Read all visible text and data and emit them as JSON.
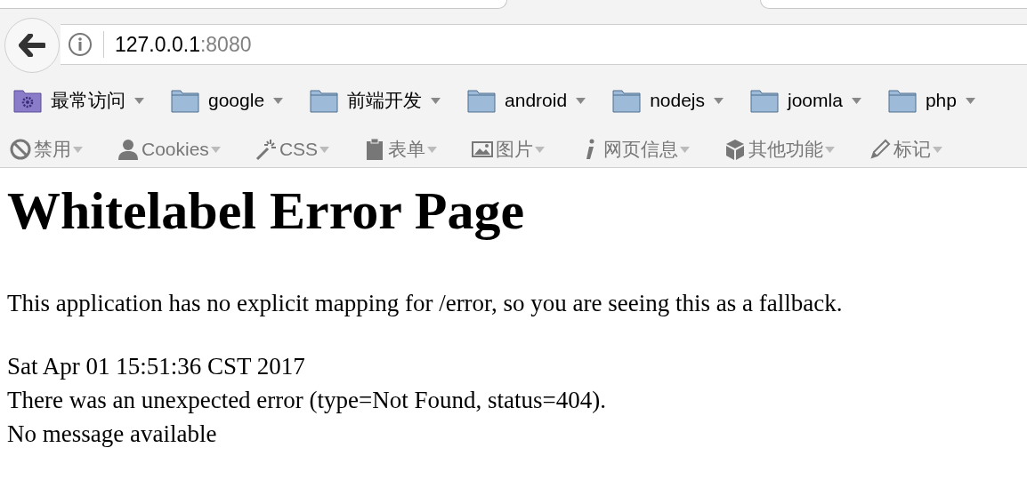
{
  "address_bar": {
    "host": "127.0.0.1",
    "port": ":8080"
  },
  "bookmarks": [
    {
      "label": "最常访问",
      "kind": "smart"
    },
    {
      "label": "google",
      "kind": "folder"
    },
    {
      "label": "前端开发",
      "kind": "folder"
    },
    {
      "label": "android",
      "kind": "folder"
    },
    {
      "label": "nodejs",
      "kind": "folder"
    },
    {
      "label": "joomla",
      "kind": "folder"
    },
    {
      "label": "php",
      "kind": "folder"
    }
  ],
  "dev_toolbar": [
    {
      "label": "禁用",
      "kind": "disable"
    },
    {
      "label": "Cookies",
      "kind": "cookies"
    },
    {
      "label": "CSS",
      "kind": "css"
    },
    {
      "label": "表单",
      "kind": "forms"
    },
    {
      "label": "图片",
      "kind": "images"
    },
    {
      "label": "网页信息",
      "kind": "info"
    },
    {
      "label": "其他功能",
      "kind": "misc"
    },
    {
      "label": "标记",
      "kind": "outline"
    }
  ],
  "page": {
    "title": "Whitelabel Error Page",
    "message": "This application has no explicit mapping for /error, so you are seeing this as a fallback.",
    "lines": [
      "Sat Apr 01 15:51:36 CST 2017",
      "There was an unexpected error (type=Not Found, status=404).",
      "No message available"
    ]
  }
}
